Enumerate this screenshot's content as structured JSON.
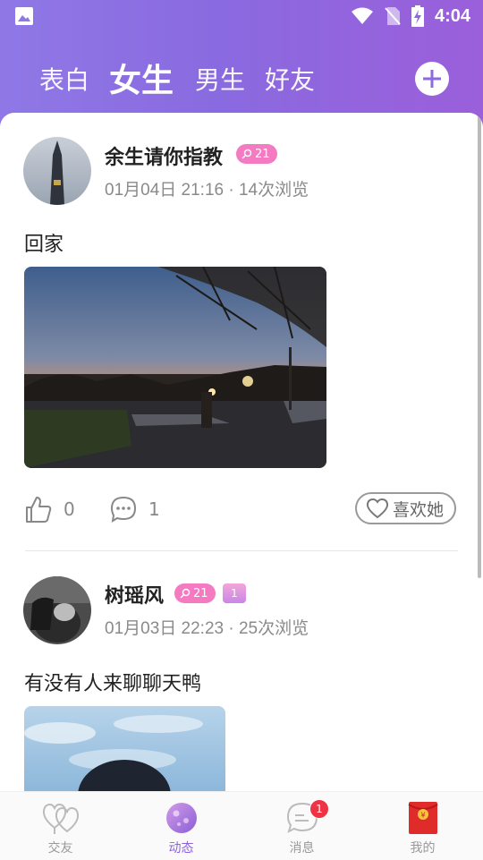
{
  "status_bar": {
    "time": "4:04"
  },
  "header": {
    "tabs": [
      {
        "label": "表白"
      },
      {
        "label": "女生"
      },
      {
        "label": "男生"
      },
      {
        "label": "好友"
      }
    ],
    "active_tab": "女生"
  },
  "posts": [
    {
      "username": "余生请你指教",
      "age": "21",
      "meta": "01月04日 21:16 · 14次浏览",
      "text": "回家",
      "likes": "0",
      "comments": "1",
      "like_her_label": "喜欢她"
    },
    {
      "username": "树瑶风",
      "age": "21",
      "vip_level": "1",
      "meta": "01月03日 22:23 · 25次浏览",
      "text": "有没有人来聊聊天鸭"
    }
  ],
  "bottom_nav": {
    "items": [
      {
        "label": "交友",
        "icon": "hearts-icon"
      },
      {
        "label": "动态",
        "icon": "planet-icon"
      },
      {
        "label": "消息",
        "icon": "chat-icon",
        "badge": "1"
      },
      {
        "label": "我的",
        "icon": "red-envelope-icon"
      }
    ],
    "active": "动态"
  },
  "colors": {
    "header_gradient_start": "#8f78e6",
    "header_gradient_end": "#9b5fdb",
    "age_badge": "#f47bc2",
    "accent": "#8e63d8",
    "notification": "#ee3344"
  }
}
